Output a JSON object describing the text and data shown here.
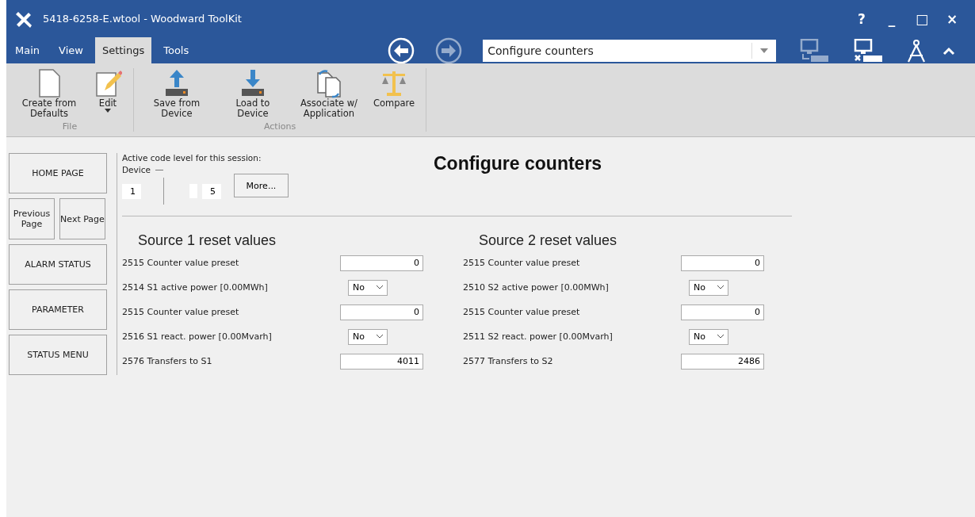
{
  "window": {
    "title": "5418-6258-E.wtool - Woodward ToolKit"
  },
  "window_controls": [
    "?",
    "_",
    "□",
    "×"
  ],
  "tabs": [
    {
      "label": "Main",
      "selected": false
    },
    {
      "label": "View",
      "selected": false
    },
    {
      "label": "Settings",
      "selected": true
    },
    {
      "label": "Tools",
      "selected": false
    }
  ],
  "navigation": {
    "back_disabled": false,
    "forward_disabled": true,
    "page_select": "Configure counters"
  },
  "ribbon": {
    "groups": [
      {
        "label": "File",
        "buttons": [
          {
            "kind": "blank",
            "label": "Create from Defaults"
          },
          {
            "kind": "edit",
            "label": "Edit",
            "dropdown": true
          }
        ]
      },
      {
        "label": "Actions",
        "buttons": [
          {
            "kind": "save",
            "label": "Save from Device"
          },
          {
            "kind": "load",
            "label": "Load to Device"
          },
          {
            "kind": "associate",
            "label": "Associate w/ Application"
          },
          {
            "kind": "compare",
            "label": "Compare"
          }
        ]
      }
    ]
  },
  "sidebar": [
    {
      "label": "HOME PAGE"
    },
    {
      "pair": [
        {
          "label": "Previous Page"
        },
        {
          "label": "Next Page"
        }
      ]
    },
    {
      "label": "ALARM STATUS"
    },
    {
      "label": "PARAMETER"
    },
    {
      "label": "STATUS MENU"
    }
  ],
  "code_level": {
    "heading": "Active code level for this session:",
    "device_label": "Device",
    "level_1": "1",
    "level_2": "5",
    "more_button": "More..."
  },
  "page_title": "Configure counters",
  "sections": [
    {
      "title": "Source 1 reset values",
      "rows": [
        {
          "kind": "number",
          "label": "2515 Counter value preset",
          "value": "0"
        },
        {
          "kind": "select",
          "label": "2514 S1 active power [0.00MWh]",
          "value": "No"
        },
        {
          "kind": "number",
          "label": "2515 Counter value preset",
          "value": "0"
        },
        {
          "kind": "select",
          "label": "2516 S1 react. power [0.00Mvarh]",
          "value": "No"
        },
        {
          "kind": "number",
          "label": "2576 Transfers to S1",
          "value": "4011"
        }
      ]
    },
    {
      "title": "Source 2 reset values",
      "rows": [
        {
          "kind": "number",
          "label": "2515 Counter value preset",
          "value": "0"
        },
        {
          "kind": "select",
          "label": "2510 S2 active power [0.00MWh]",
          "value": "No"
        },
        {
          "kind": "number",
          "label": "2515 Counter value preset",
          "value": "0"
        },
        {
          "kind": "select",
          "label": "2511 S2 react. power [0.00Mvarh]",
          "value": "No"
        },
        {
          "kind": "number",
          "label": "2577 Transfers to S2",
          "value": "2486"
        }
      ]
    }
  ]
}
